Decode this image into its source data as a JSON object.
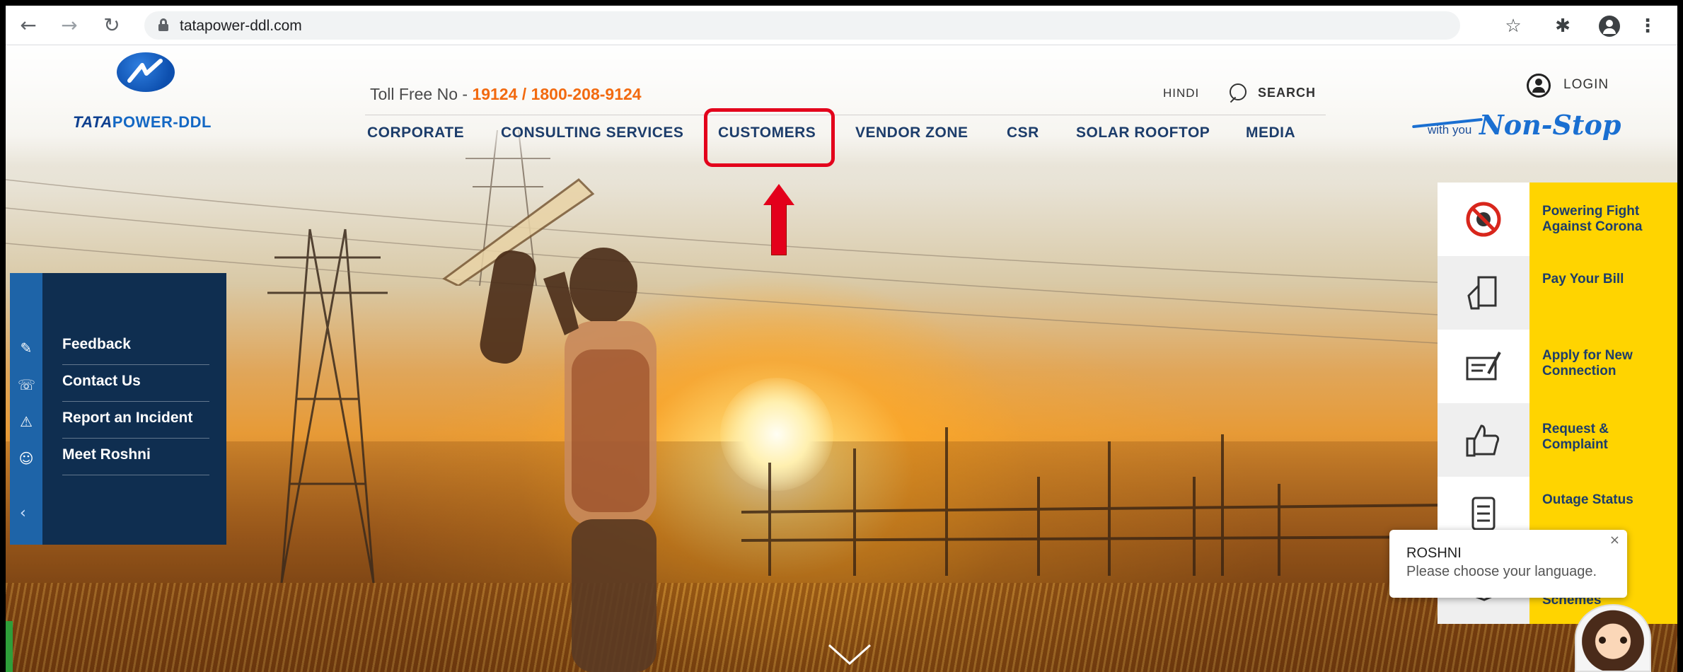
{
  "browser": {
    "url": "tatapower-ddl.com",
    "back_icon": "arrow-left-icon",
    "forward_icon": "arrow-right-icon",
    "reload_icon": "reload-icon"
  },
  "brand": {
    "name_a": "TATA",
    "name_b": "POWER-DDL",
    "tagline_small": "with you",
    "tagline_big": "Non-Stop",
    "color_primary": "#1468c4",
    "color_accent": "#f26a10"
  },
  "header": {
    "toll_prefix": "Toll Free No - ",
    "toll_numbers": "19124 / 1800-208-9124",
    "hindi": "HINDI",
    "search": "SEARCH",
    "login": "LOGIN"
  },
  "nav": [
    {
      "label": "CORPORATE"
    },
    {
      "label": "CONSULTING SERVICES"
    },
    {
      "label": "CUSTOMERS"
    },
    {
      "label": "VENDOR ZONE"
    },
    {
      "label": "CSR"
    },
    {
      "label": "SOLAR ROOFTOP"
    },
    {
      "label": "MEDIA"
    }
  ],
  "annotation": {
    "highlight_color": "#e3001b",
    "highlighted_item": "CUSTOMERS"
  },
  "left_widget": {
    "items": [
      {
        "label": "Feedback",
        "icon": "feedback-icon"
      },
      {
        "label": "Contact Us",
        "icon": "phone-icon"
      },
      {
        "label": "Report an Incident",
        "icon": "incident-icon"
      },
      {
        "label": "Meet Roshni",
        "icon": "roshni-icon"
      }
    ],
    "collapse_icon": "chevron-left-icon"
  },
  "quick_links": [
    {
      "label_html_parts": [
        "P",
        "owering ",
        "F",
        "ight ",
        "A",
        "gainst ",
        "C",
        "orona"
      ],
      "label": "Powering Fight Against Corona",
      "icon": "no-virus-icon"
    },
    {
      "label": "Pay Your Bill",
      "icon": "bill-icon"
    },
    {
      "label": "Apply for New Connection",
      "icon": "form-icon"
    },
    {
      "label": "Request & Complaint",
      "icon": "thumbs-up-icon"
    },
    {
      "label": "Outage Status",
      "icon": "document-icon"
    },
    {
      "label": "Schemes",
      "icon": "handshake-icon"
    }
  ],
  "chat": {
    "name": "ROSHNI",
    "message": "Please choose your language.",
    "close": "×"
  }
}
